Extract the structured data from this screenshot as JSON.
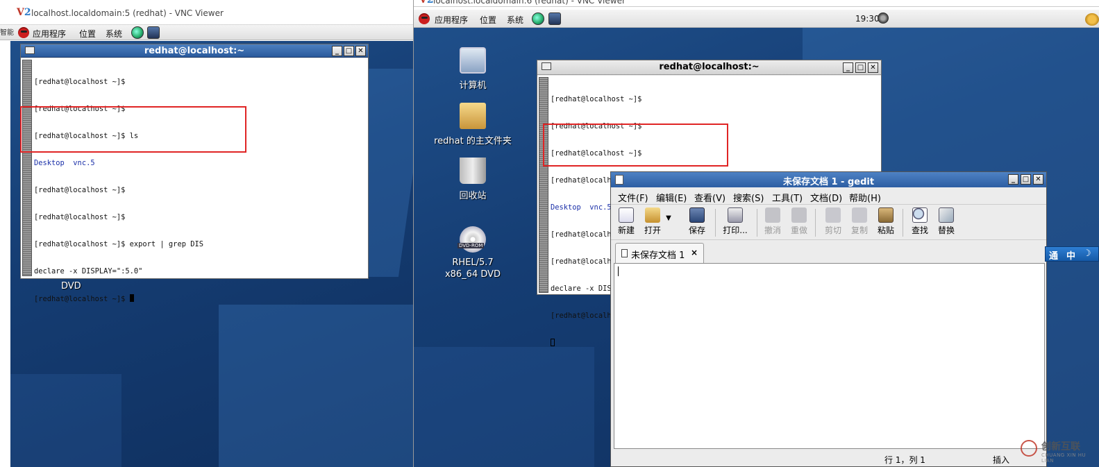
{
  "left_vnc": {
    "title": "localhost.localdomain:5 (redhat) - VNC Viewer",
    "logo_v": "V",
    "logo_2": "2",
    "side_label": "智能",
    "panel": {
      "apps": "应用程序",
      "places": "位置",
      "system": "系统"
    },
    "desktop_dvd_label": "DVD",
    "terminal": {
      "title": "redhat@localhost:~",
      "lines": [
        "[redhat@localhost ~]$",
        "[redhat@localhost ~]$",
        "[redhat@localhost ~]$ ls",
        "Desktop  vnc.5",
        "[redhat@localhost ~]$",
        "[redhat@localhost ~]$",
        "[redhat@localhost ~]$ export | grep DIS",
        "declare -x DISPLAY=\":5.0\"",
        "[redhat@localhost ~]$ "
      ]
    }
  },
  "right_vnc": {
    "title": "localhost.localdomain:6 (redhat) - VNC Viewer",
    "logo_v": "V",
    "logo_2": "2",
    "close_glyph": "—",
    "panel": {
      "apps": "应用程序",
      "places": "位置",
      "system": "系统",
      "clock": "19:30"
    },
    "desktop_icons": [
      {
        "label": "计算机"
      },
      {
        "label": "redhat 的主文件夹"
      },
      {
        "label": "回收站"
      },
      {
        "label": "RHEL/5.7 x86_64 DVD"
      }
    ],
    "dvd_badge": "DVD-ROM",
    "terminal": {
      "title": "redhat@localhost:~",
      "lines": [
        "[redhat@localhost ~]$",
        "[redhat@localhost ~]$",
        "[redhat@localhost ~]$",
        "[redhat@localhost ~]$ ls",
        "Desktop  vnc.5",
        "[redhat@localhost ~]$",
        "[redhat@localhost ~]$ export | grep DIS",
        "declare -x DISPLAY=\":6.0\"",
        "[redhat@localhost ~]$ gedit",
        ""
      ]
    },
    "gedit": {
      "title": "未保存文档 1 - gedit",
      "menu": [
        "文件(F)",
        "编辑(E)",
        "查看(V)",
        "搜索(S)",
        "工具(T)",
        "文档(D)",
        "帮助(H)"
      ],
      "toolbar": {
        "new": "新建",
        "open": "打开",
        "save": "保存",
        "print": "打印...",
        "undo": "撤消",
        "redo": "重做",
        "cut": "剪切",
        "copy": "复制",
        "paste": "粘贴",
        "find": "查找",
        "replace": "替换"
      },
      "tab_label": "未保存文档 1",
      "tab_close": "×",
      "status_position": "行 1，列 1",
      "status_mode": "插入"
    },
    "ime": {
      "mode1": "通",
      "mode2": "中",
      "mode3": "☽"
    }
  },
  "watermark": {
    "text": "创新互联",
    "sub": "CHUANG XIN HU LIAN"
  }
}
